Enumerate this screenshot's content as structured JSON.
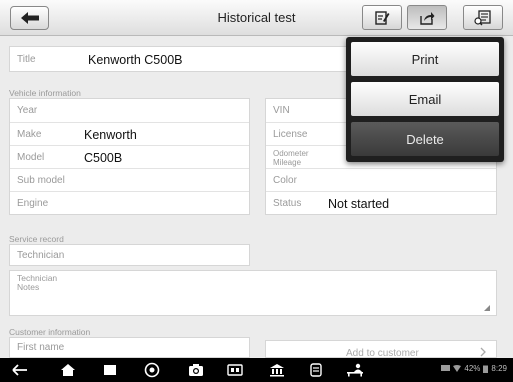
{
  "header": {
    "title": "Historical test"
  },
  "menu": {
    "items": [
      {
        "label": "Print"
      },
      {
        "label": "Email"
      },
      {
        "label": "Delete"
      }
    ]
  },
  "form": {
    "title": {
      "label": "Title",
      "value": "Kenworth C500B"
    },
    "vehicle_section": "Vehicle information",
    "left_rows": [
      {
        "label": "Year",
        "value": ""
      },
      {
        "label": "Make",
        "value": "Kenworth"
      },
      {
        "label": "Model",
        "value": "C500B"
      },
      {
        "label": "Sub model",
        "value": ""
      },
      {
        "label": "Engine",
        "value": ""
      }
    ],
    "right_rows": [
      {
        "label": "VIN",
        "value": ""
      },
      {
        "label": "License",
        "value": ""
      },
      {
        "label": "Odometer Mileage",
        "value": ""
      },
      {
        "label": "Color",
        "value": ""
      },
      {
        "label": "Status",
        "value": "Not started"
      }
    ],
    "service_section": "Service record",
    "technician": {
      "label": "Technician"
    },
    "technician_notes": {
      "label": "Technician Notes"
    },
    "customer_section": "Customer information",
    "first_name": {
      "label": "First name"
    },
    "add_customer": "Add to customer"
  },
  "statusbar": {
    "battery": "42%",
    "time": "8:29"
  },
  "colors": {
    "dropdown_bg": "#1f1f1f",
    "navbar_bg": "#000000"
  }
}
